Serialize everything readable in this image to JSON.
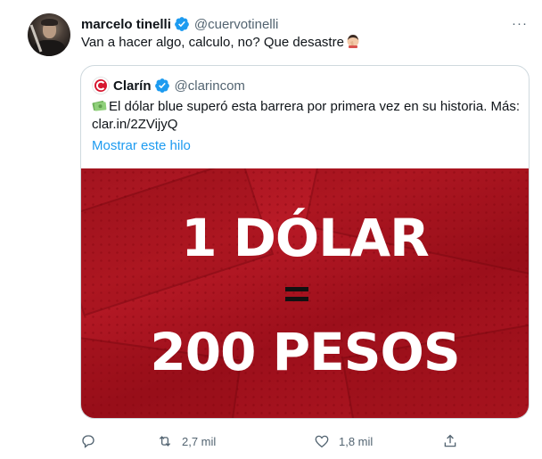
{
  "tweet": {
    "author_name": "marcelo tinelli",
    "author_handle": "@cuervotinelli",
    "text": "Van a hacer algo, calculo, no? Que desastre",
    "more_icon": "more-dots-icon"
  },
  "quoted": {
    "author_name": "Clarín",
    "author_handle": "@clarincom",
    "text": "El dólar blue superó esta barrera por primera vez en su historia. Más: clar.in/2ZVijyQ",
    "show_thread": "Mostrar este hilo",
    "media": {
      "line1": "1 DÓLAR",
      "line2": "=",
      "line3": "200 PESOS",
      "background_color": "#b0161f"
    }
  },
  "actions": {
    "reply_icon": "reply-icon",
    "retweet_count": "2,7 mil",
    "like_count": "1,8 mil",
    "share_icon": "share-icon"
  },
  "colors": {
    "accent": "#1d9bf0",
    "secondary_text": "#536471",
    "border": "#cfd9de"
  }
}
